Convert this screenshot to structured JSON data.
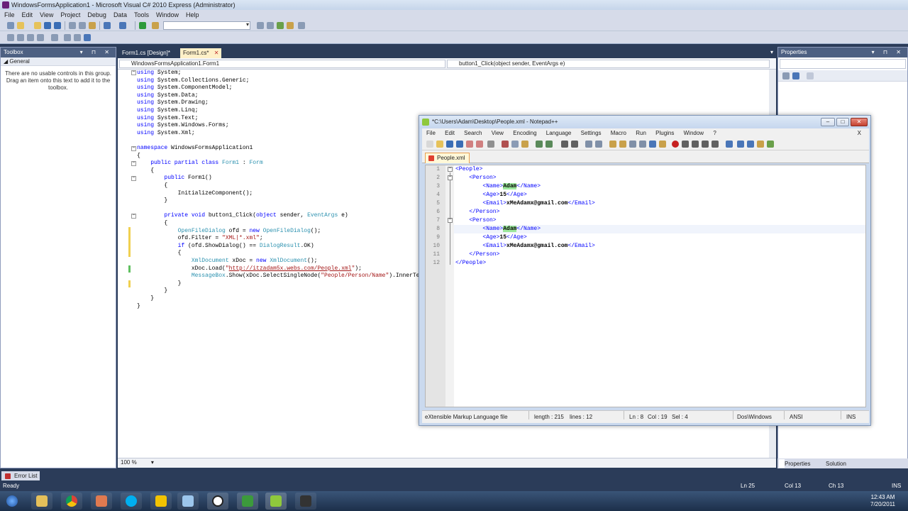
{
  "vs": {
    "title": "WindowsFormsApplication1 - Microsoft Visual C# 2010 Express (Administrator)",
    "menu": [
      "File",
      "Edit",
      "View",
      "Project",
      "Debug",
      "Data",
      "Tools",
      "Window",
      "Help"
    ],
    "tabs": [
      {
        "label": "Form1.cs [Design]*",
        "active": false
      },
      {
        "label": "Form1.cs*",
        "active": true,
        "close": "✕"
      }
    ],
    "tabs_overflow": "▾",
    "nav_left": "WindowsFormsApplication1.Form1",
    "nav_right": "button1_Click(object sender, EventArgs e)",
    "zoom": "100 %",
    "code": [
      "using System;",
      "using System.Collections.Generic;",
      "using System.ComponentModel;",
      "using System.Data;",
      "using System.Drawing;",
      "using System.Linq;",
      "using System.Text;",
      "using System.Windows.Forms;",
      "using System.Xml;",
      "",
      "namespace WindowsFormsApplication1",
      "{",
      "    public partial class Form1 : Form",
      "    {",
      "        public Form1()",
      "        {",
      "            InitializeComponent();",
      "        }",
      "",
      "        private void button1_Click(object sender, EventArgs e)",
      "        {",
      "            OpenFileDialog ofd = new OpenFileDialog();",
      "            ofd.Filter = \"XML|*.xml\";",
      "            if (ofd.ShowDialog() == DialogResult.OK)",
      "            {",
      "                XmlDocument xDoc = new XmlDocument();",
      "                xDoc.Load(\"http://itzadam5x.webs.com/People.xml\");",
      "                MessageBox.Show(xDoc.SelectSingleNode(\"People/Person/Name\").InnerText",
      "            }",
      "        }",
      "    }",
      "}"
    ]
  },
  "toolbox": {
    "title": "Toolbox",
    "group": "General",
    "message": "There are no usable controls in this group. Drag an item onto this text to add it to the toolbox."
  },
  "properties": {
    "title": "Properties",
    "tabs": [
      "Properties",
      "Solution Explorer"
    ]
  },
  "error_list": {
    "label": "Error List"
  },
  "status": {
    "ready": "Ready",
    "ln": "Ln 25",
    "col": "Col 13",
    "ch": "Ch 13",
    "ins": "INS"
  },
  "clock": {
    "time": "12:43 AM",
    "date": "7/20/2011"
  },
  "npp": {
    "title": "*C:\\Users\\Adam\\Desktop\\People.xml - Notepad++",
    "menu": [
      "File",
      "Edit",
      "Search",
      "View",
      "Encoding",
      "Language",
      "Settings",
      "Macro",
      "Run",
      "Plugins",
      "Window",
      "?"
    ],
    "menu_close": "X",
    "tab": "People.xml",
    "line_numbers": [
      "1",
      "2",
      "3",
      "4",
      "5",
      "6",
      "7",
      "8",
      "9",
      "10",
      "11",
      "12"
    ],
    "status": {
      "filetype": "eXtensible Markup Language file",
      "length": "length : 215",
      "lines": "lines : 12",
      "ln": "Ln : 8",
      "col": "Col : 19",
      "sel": "Sel : 4",
      "eol": "Dos\\Windows",
      "encoding": "ANSI",
      "mode": "INS"
    },
    "xml": [
      {
        "indent": "",
        "open": "<People>",
        "text": "",
        "close": ""
      },
      {
        "indent": "    ",
        "open": "<Person>",
        "text": "",
        "close": ""
      },
      {
        "indent": "        ",
        "open": "<Name>",
        "text": "Adam",
        "close": "</Name>",
        "hl": true
      },
      {
        "indent": "        ",
        "open": "<Age>",
        "text": "15",
        "close": "</Age>"
      },
      {
        "indent": "        ",
        "open": "<Email>",
        "text": "xMeAdamx@gmail.com",
        "close": "</Email>"
      },
      {
        "indent": "    ",
        "open": "</Person>",
        "text": "",
        "close": ""
      },
      {
        "indent": "    ",
        "open": "<Person>",
        "text": "",
        "close": ""
      },
      {
        "indent": "        ",
        "open": "<Name>",
        "text": "Adam",
        "close": "</Name>",
        "hl": true
      },
      {
        "indent": "        ",
        "open": "<Age>",
        "text": "15",
        "close": "</Age>"
      },
      {
        "indent": "        ",
        "open": "<Email>",
        "text": "xMeAdamx@gmail.com",
        "close": "</Email>"
      },
      {
        "indent": "    ",
        "open": "</Person>",
        "text": "",
        "close": ""
      },
      {
        "indent": "",
        "open": "</People>",
        "text": "",
        "close": ""
      }
    ]
  },
  "taskbar": {
    "icons": [
      "start-orb-icon",
      "explorer-icon",
      "chrome-icon",
      "paint-icon",
      "skype-icon",
      "aim-icon",
      "notepad-icon",
      "unity-icon",
      "csharp-icon",
      "notepadpp-icon",
      "camtasia-icon"
    ]
  }
}
